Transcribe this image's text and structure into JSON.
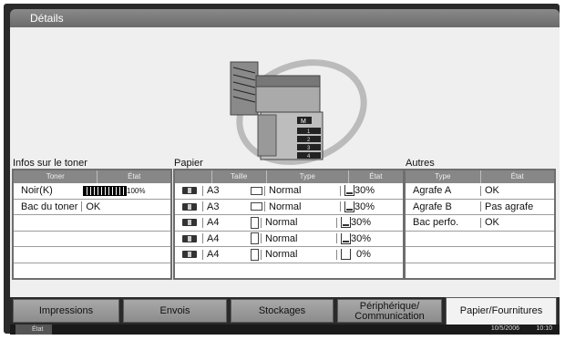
{
  "window": {
    "title": "Détails"
  },
  "toner": {
    "title": "Infos sur le toner",
    "headers": [
      "Toner",
      "État"
    ],
    "rows": [
      {
        "name": "Noir(K)",
        "level": 100,
        "level_label": "100%"
      },
      {
        "name": "Bac du toner",
        "status": "OK"
      }
    ]
  },
  "paper": {
    "title": "Papier",
    "headers": [
      "",
      "Taille",
      "Type",
      "État"
    ],
    "rows": [
      {
        "tray": "1",
        "size": "A3",
        "type": "Normal",
        "level": "30%",
        "orientation": "landscape"
      },
      {
        "tray": "2",
        "size": "A3",
        "type": "Normal",
        "level": "30%",
        "orientation": "landscape"
      },
      {
        "tray": "3",
        "size": "A4",
        "type": "Normal",
        "level": "30%",
        "orientation": "portrait"
      },
      {
        "tray": "4",
        "size": "A4",
        "type": "Normal",
        "level": "30%",
        "orientation": "portrait"
      },
      {
        "tray": "M",
        "size": "A4",
        "type": "Normal",
        "level": "0%",
        "orientation": "portrait"
      }
    ]
  },
  "others": {
    "title": "Autres",
    "headers": [
      "Type",
      "État"
    ],
    "rows": [
      {
        "name": "Agrafe A",
        "status": "OK"
      },
      {
        "name": "Agrafe B",
        "status": "Pas agrafe"
      },
      {
        "name": "Bac perfo.",
        "status": "OK"
      }
    ]
  },
  "tabs": [
    {
      "label": "Impressions",
      "active": false
    },
    {
      "label": "Envois",
      "active": false
    },
    {
      "label": "Stockages",
      "active": false
    },
    {
      "label": "Périphérique/\nCommunication",
      "active": false
    },
    {
      "label": "Papier/Fournitures",
      "active": true
    }
  ],
  "status_bar": {
    "label": "État",
    "date": "10/5/2006",
    "time": "10:10"
  }
}
